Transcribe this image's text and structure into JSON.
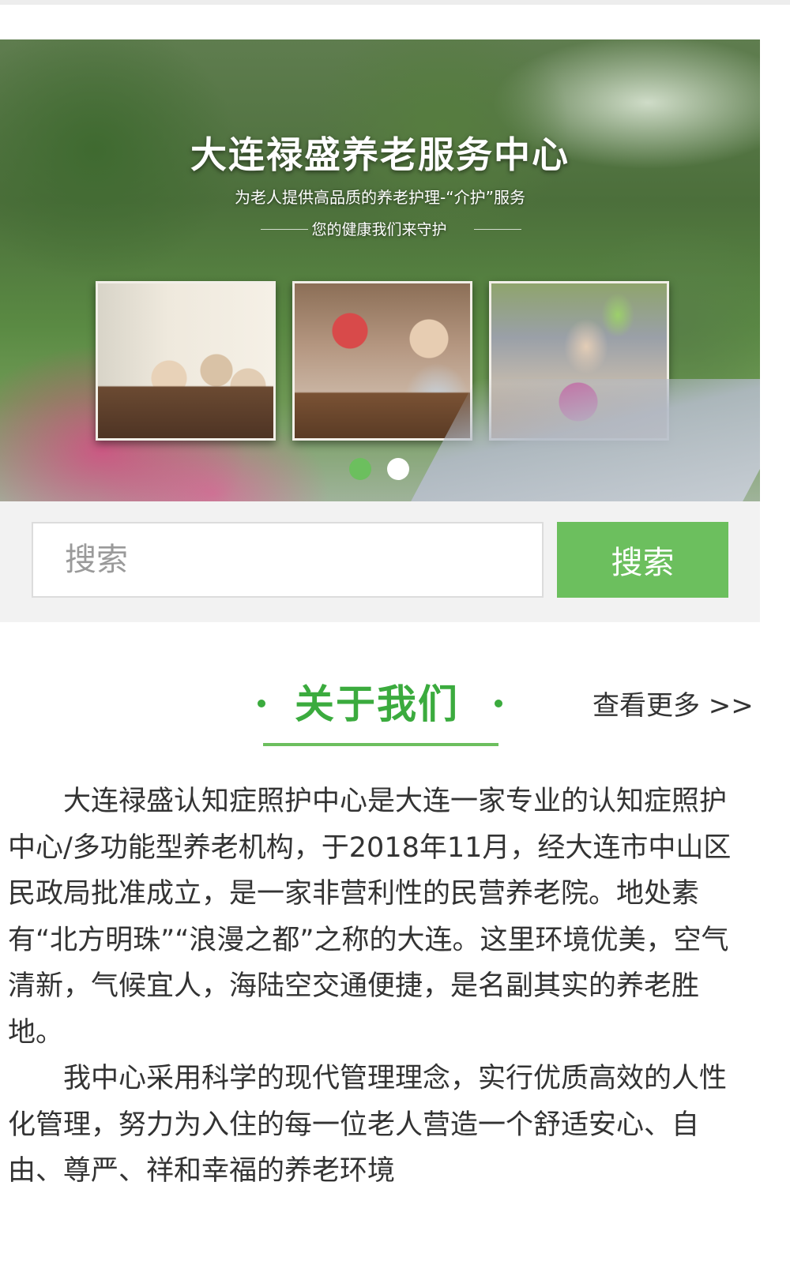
{
  "banner": {
    "title": "大连禄盛养老服务中心",
    "subtitle": "为老人提供高品质的养老护理-“介护”服务",
    "slogan": "您的健康我们来守护",
    "slide_count": 2,
    "active_slide": 1
  },
  "search": {
    "placeholder": "搜索",
    "button_label": "搜索"
  },
  "about": {
    "title": "关于我们",
    "more_label": "查看更多 >>",
    "paragraphs": [
      "大连禄盛认知症照护中心是大连一家专业的认知症照护中心/多功能型养老机构，于2018年11月，经大连市中山区民政局批准成立，是一家非营利性的民营养老院。地处素有“北方明珠”“浪漫之都”之称的大连。这里环境优美，空气清新，气候宜人，海陆空交通便捷，是名副其实的养老胜地。",
      "我中心采用科学的现代管理理念，实行优质高效的人性化管理，努力为入住的每一位老人营造一个舒适安心、自由、尊严、祥和幸福的养老环境"
    ]
  },
  "colors": {
    "accent_green": "#6cbf5e",
    "title_green": "#3bab3e",
    "search_bg": "#f2f2f2"
  }
}
